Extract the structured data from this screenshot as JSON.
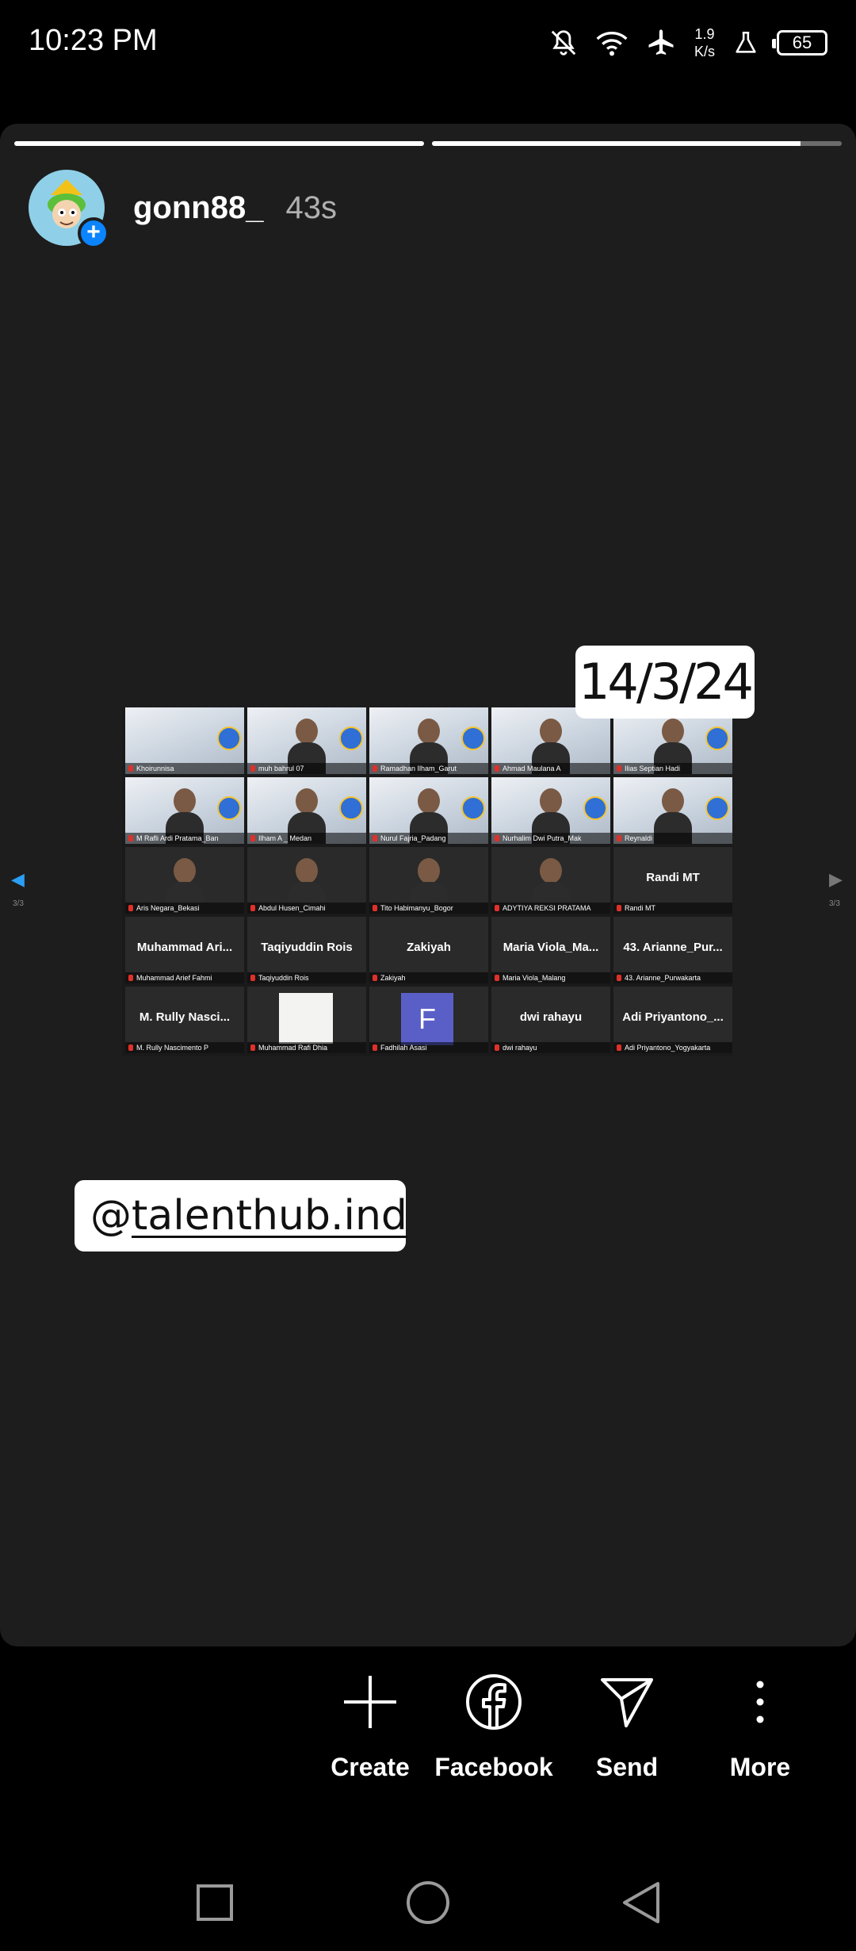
{
  "status_bar": {
    "time": "10:23 PM",
    "net_speed_value": "1.9",
    "net_speed_unit": "K/s",
    "battery": "65",
    "icons": [
      "mute-notifications-icon",
      "wifi-icon",
      "airplane-mode-icon",
      "lab-icon",
      "battery-icon"
    ]
  },
  "story": {
    "progress": [
      1.0,
      0.9
    ],
    "username": "gonn88_",
    "time_ago": "43s",
    "date_sticker": "14/3/24",
    "mention_prefix": "@",
    "mention_handle": "talenthub.ind"
  },
  "meeting": {
    "page_indicator_left": "3/3",
    "page_indicator_right": "3/3",
    "tiles": [
      {
        "label": "Khoirunnisa",
        "big": ""
      },
      {
        "label": "muh bahrul 07",
        "big": ""
      },
      {
        "label": "Ramadhan Ilham_Garut",
        "big": ""
      },
      {
        "label": "Ahmad Maulana A",
        "big": ""
      },
      {
        "label": "Ilias Septian Hadi",
        "big": ""
      },
      {
        "label": "M Rafli Ardi Pratama_Ban",
        "big": ""
      },
      {
        "label": "Ilham A _ Medan",
        "big": ""
      },
      {
        "label": "Nurul Fajria_Padang",
        "big": ""
      },
      {
        "label": "Nurhalim Dwi Putra_Mak",
        "big": ""
      },
      {
        "label": "Reynaldi",
        "big": ""
      },
      {
        "label": "Aris Negara_Bekasi",
        "big": ""
      },
      {
        "label": "Abdul Husen_Cimahi",
        "big": ""
      },
      {
        "label": "Tito Habimanyu_Bogor",
        "big": ""
      },
      {
        "label": "ADYTIYA REKSI PRATAMA",
        "big": ""
      },
      {
        "label": "Randi MT",
        "big": "Randi MT"
      },
      {
        "label": "Muhammad Arief Fahmi",
        "big": "Muhammad  Ari..."
      },
      {
        "label": "Taqiyuddin Rois",
        "big": "Taqiyuddin Rois"
      },
      {
        "label": "Zakiyah",
        "big": "Zakiyah"
      },
      {
        "label": "Maria Viola_Malang",
        "big": "Maria  Viola_Ma..."
      },
      {
        "label": "43. Arianne_Purwakarta",
        "big": "43.  Arianne_Pur..."
      },
      {
        "label": "M. Rully Nascimento P",
        "big": "M. Rully  Nasci..."
      },
      {
        "label": "Muhammad Rafi Dhia",
        "big": ""
      },
      {
        "label": "Fadhilah Asasi",
        "big": "",
        "initial": "F"
      },
      {
        "label": "dwi rahayu",
        "big": "dwi rahayu"
      },
      {
        "label": "Adi Priyantono_Yogyakarta",
        "big": "Adi  Priyantono_..."
      }
    ]
  },
  "actions": {
    "create": "Create",
    "facebook": "Facebook",
    "send": "Send",
    "more": "More"
  },
  "colors": {
    "story_bg": "#1d1d1d",
    "accent": "#0a84ff"
  }
}
